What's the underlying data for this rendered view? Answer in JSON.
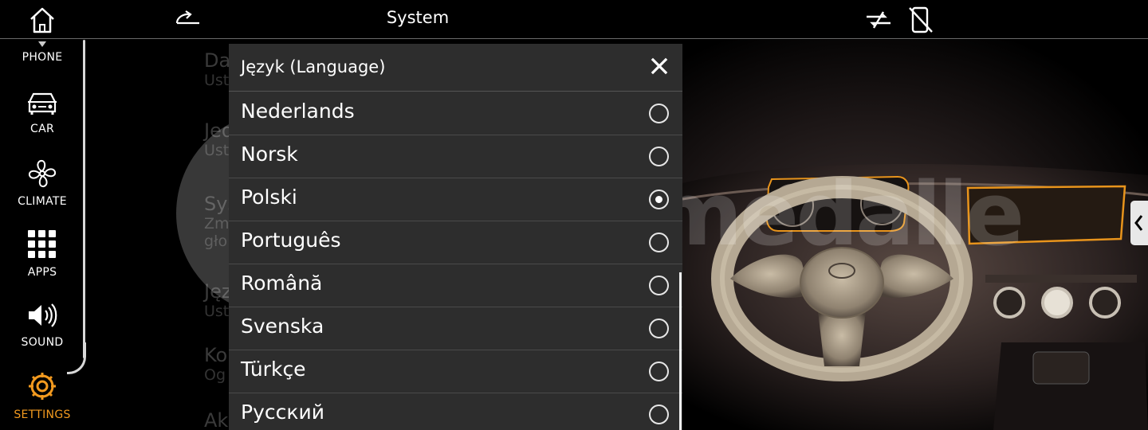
{
  "header": {
    "title": "System"
  },
  "sidebar": {
    "items": [
      {
        "label": "PHONE",
        "icon": "phone-icon"
      },
      {
        "label": "CAR",
        "icon": "car-icon"
      },
      {
        "label": "CLIMATE",
        "icon": "fan-icon"
      },
      {
        "label": "APPS",
        "icon": "grid-icon"
      },
      {
        "label": "SOUND",
        "icon": "speaker-icon"
      },
      {
        "label": "SETTINGS",
        "icon": "gear-icon",
        "active": true
      }
    ]
  },
  "background_list": {
    "items": [
      {
        "title": "Da",
        "subtitle": "Ust"
      },
      {
        "title": "Jed",
        "subtitle": "Ust"
      },
      {
        "title": "Sys",
        "subtitle": "Zm",
        "subtitle2": "gło"
      },
      {
        "title": "Jęz",
        "subtitle": "Ust"
      },
      {
        "title": "Ko",
        "subtitle": "Og"
      },
      {
        "title": "Ak",
        "subtitle": ""
      }
    ]
  },
  "modal": {
    "title": "Język (Language)",
    "close_label": "X",
    "options": [
      {
        "label": "Nederlands",
        "selected": false
      },
      {
        "label": "Norsk",
        "selected": false
      },
      {
        "label": "Polski",
        "selected": true
      },
      {
        "label": "Português",
        "selected": false
      },
      {
        "label": "Română",
        "selected": false
      },
      {
        "label": "Svenska",
        "selected": false
      },
      {
        "label": "Türkçe",
        "selected": false
      },
      {
        "label": "Русский",
        "selected": false
      }
    ]
  },
  "watermark": {
    "text": "blackmedalle"
  },
  "colors": {
    "accent": "#f39a1f",
    "modal_bg": "#2d2d2d",
    "highlight_orange": "#e8941c"
  }
}
